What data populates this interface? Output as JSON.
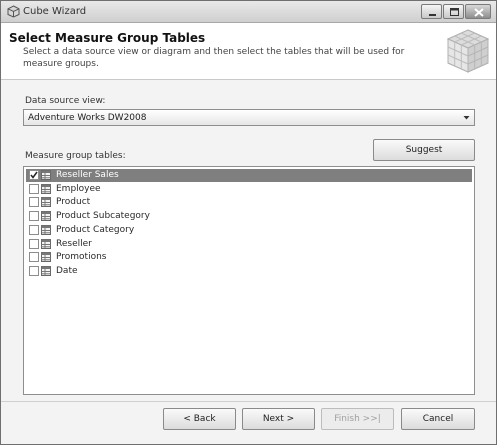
{
  "window": {
    "title": "Cube Wizard"
  },
  "header": {
    "title": "Select Measure Group Tables",
    "description": "Select a data source view or diagram and then select the tables that will be used for measure groups."
  },
  "data_source_view": {
    "label": "Data source view:",
    "value": "Adventure Works DW2008"
  },
  "measure_group_tables": {
    "label": "Measure group tables:",
    "suggest_label": "Suggest",
    "items": [
      {
        "label": "Reseller Sales",
        "checked": true,
        "selected": true
      },
      {
        "label": "Employee",
        "checked": false,
        "selected": false
      },
      {
        "label": "Product",
        "checked": false,
        "selected": false
      },
      {
        "label": "Product Subcategory",
        "checked": false,
        "selected": false
      },
      {
        "label": "Product Category",
        "checked": false,
        "selected": false
      },
      {
        "label": "Reseller",
        "checked": false,
        "selected": false
      },
      {
        "label": "Promotions",
        "checked": false,
        "selected": false
      },
      {
        "label": "Date",
        "checked": false,
        "selected": false
      }
    ]
  },
  "footer": {
    "back_label": "< Back",
    "next_label": "Next >",
    "finish_label": "Finish >>|",
    "cancel_label": "Cancel"
  },
  "icons": {
    "app": "cube-icon",
    "table": "table-icon",
    "header_graphic": "cube-grid-icon",
    "dropdown": "chevron-down-icon"
  }
}
